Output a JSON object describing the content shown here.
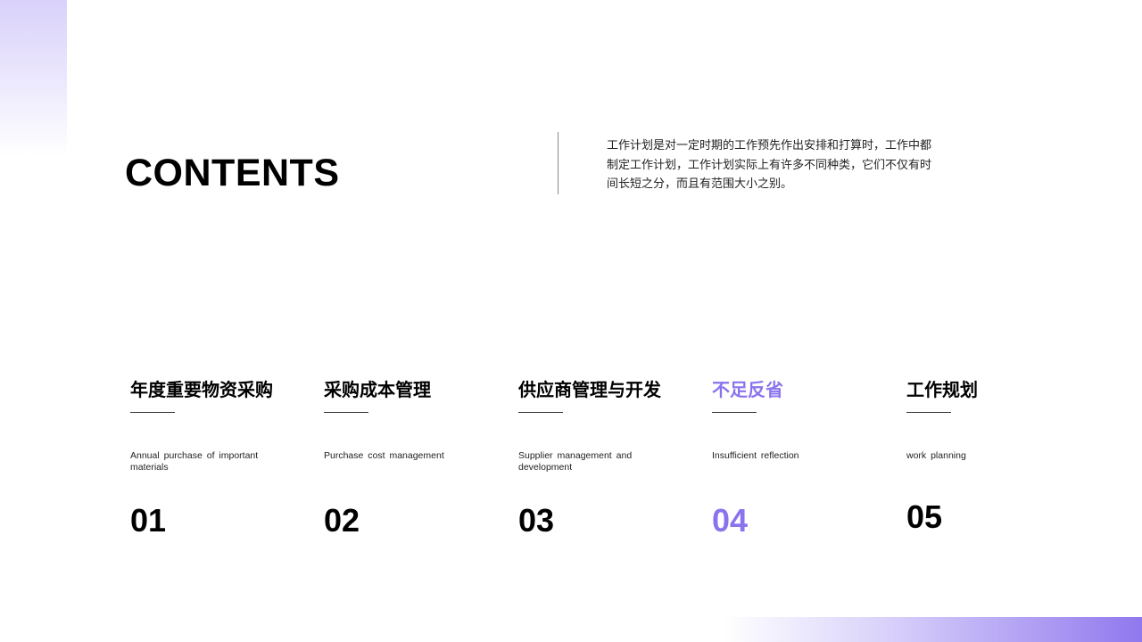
{
  "slide": {
    "title": "CONTENTS",
    "intro": "工作计划是对一定时期的工作预先作出安排和打算时，工作中都制定工作计划，工作计划实际上有许多不同种类，它们不仅有时间长短之分，而且有范围大小之别。",
    "accent_color": "#8b73ee"
  },
  "items": [
    {
      "heading": "年度重要物资采购",
      "subtitle": "Annual purchase of important materials",
      "number": "01",
      "highlighted": false
    },
    {
      "heading": "采购成本管理",
      "subtitle": "Purchase cost management",
      "number": "02",
      "highlighted": false
    },
    {
      "heading": "供应商管理与开发",
      "subtitle": "Supplier management and development",
      "number": "03",
      "highlighted": false
    },
    {
      "heading": "不足反省",
      "subtitle": "Insufficient reflection",
      "number": "04",
      "highlighted": true
    },
    {
      "heading": "工作规划",
      "subtitle": "work planning",
      "number": "05",
      "highlighted": false
    }
  ]
}
